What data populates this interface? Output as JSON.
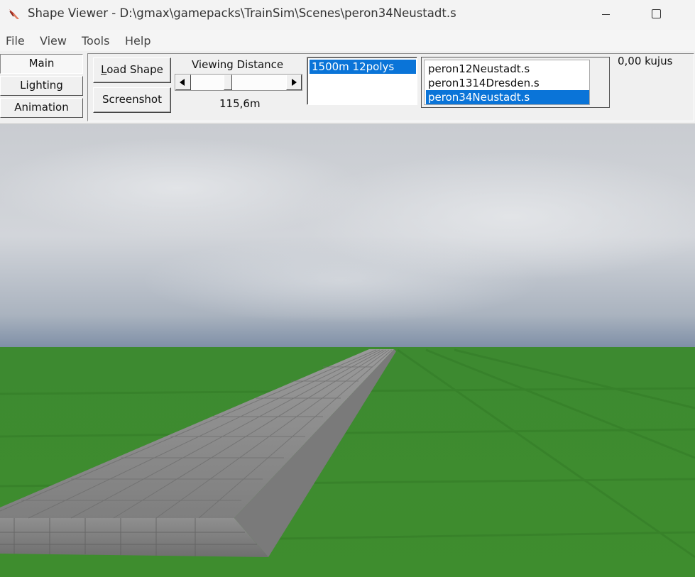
{
  "window": {
    "title": "Shape Viewer - D:\\gmax\\gamepacks\\TrainSim\\Scenes\\peron34Neustadt.s",
    "icon": "shape-viewer-app-icon"
  },
  "menu": {
    "file": "File",
    "view": "View",
    "tools": "Tools",
    "help": "Help"
  },
  "side_tabs": {
    "main": "Main",
    "lighting": "Lighting",
    "animation": "Animation",
    "active": "Main"
  },
  "toolbar": {
    "load_shape_prefix": "L",
    "load_shape_rest": "oad Shape",
    "screenshot": "Screenshot",
    "viewing_distance_label": "Viewing Distance",
    "viewing_distance_value": "115,6m",
    "viewing_distance_fraction": 0.38
  },
  "lod_list": {
    "items": [
      "1500m 12polys"
    ],
    "selected_index": 0
  },
  "shape_list": {
    "items": [
      "peron12Neustadt.s",
      "peron1314Dresden.s",
      "peron34Neustadt.s"
    ],
    "selected_index": 2
  },
  "status": {
    "count_label": "0,00 kujus"
  },
  "colors": {
    "selection": "#0a74d8",
    "grass": "#3f8f2f",
    "sky": "#b8bfc8",
    "platform": "#8a8a8a"
  }
}
